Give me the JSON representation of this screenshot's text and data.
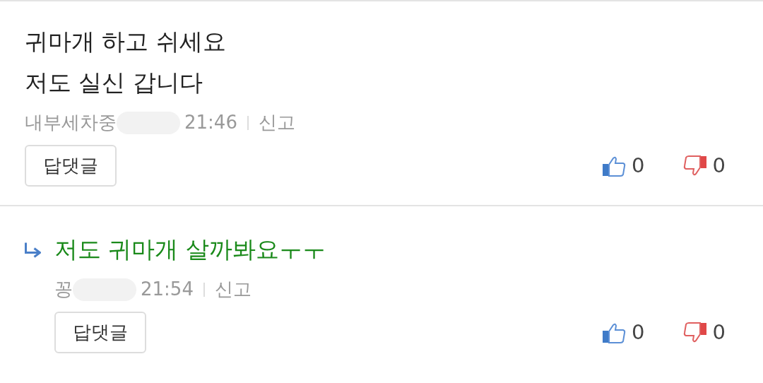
{
  "comments": [
    {
      "kind": "comment",
      "lines": [
        "귀마개 하고 쉬세요",
        "저도 실신 갑니다"
      ],
      "author": "내부세차중",
      "time": "21:46",
      "report": "신고",
      "reply_button": "답댓글",
      "likes": "0",
      "dislikes": "0"
    },
    {
      "kind": "reply",
      "lines": [
        "저도 귀마개 살까봐요ㅜㅜ"
      ],
      "author": "꽁",
      "time": "21:54",
      "report": "신고",
      "reply_button": "답댓글",
      "likes": "0",
      "dislikes": "0"
    }
  ]
}
